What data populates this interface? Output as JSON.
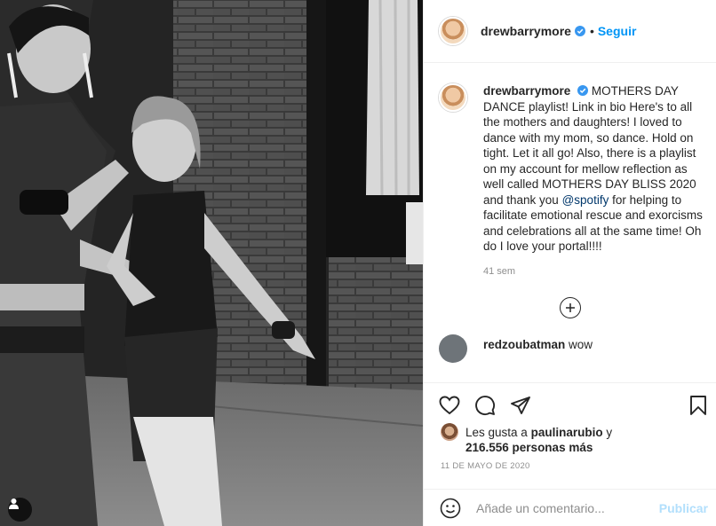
{
  "header": {
    "username": "drewbarrymore",
    "separator": "•",
    "follow_label": "Seguir"
  },
  "caption": {
    "username": "drewbarrymore",
    "text_before_mention": "MOTHERS DAY DANCE playlist! Link in bio Here's to all the mothers and daughters! I loved to dance with my mom, so dance. Hold on tight. Let it all go! Also, there is a playlist on my account for mellow reflection as well called MOTHERS DAY BLISS 2020 and thank you",
    "mention": "@spotify",
    "text_after_mention": "for helping to facilitate emotional rescue and exorcisms and celebrations all at the same time! Oh do I love your portal!!!!",
    "time_ago": "41 sem"
  },
  "comments": [
    {
      "username": "redzoubatman",
      "text": "wow"
    }
  ],
  "likes": {
    "prefix": "Les gusta a",
    "user": "paulinarubio",
    "conjunction": "y",
    "count": "216.556 personas más"
  },
  "date": "11 DE MAYO DE 2020",
  "comment_box": {
    "placeholder": "Añade un comentario...",
    "publish_label": "Publicar"
  },
  "icons": {
    "verified": "verified-badge-icon",
    "like": "heart-icon",
    "comment": "comment-bubble-icon",
    "share": "paper-plane-icon",
    "save": "bookmark-icon",
    "more": "plus-circle-icon",
    "emoji": "smiley-icon",
    "tags": "user-tag-icon"
  },
  "colors": {
    "link_blue": "#0095f6",
    "publish_disabled": "#b2dffc",
    "verified_blue": "#3897f0",
    "mention_blue": "#00376b",
    "muted_gray": "#8e8e8e"
  }
}
